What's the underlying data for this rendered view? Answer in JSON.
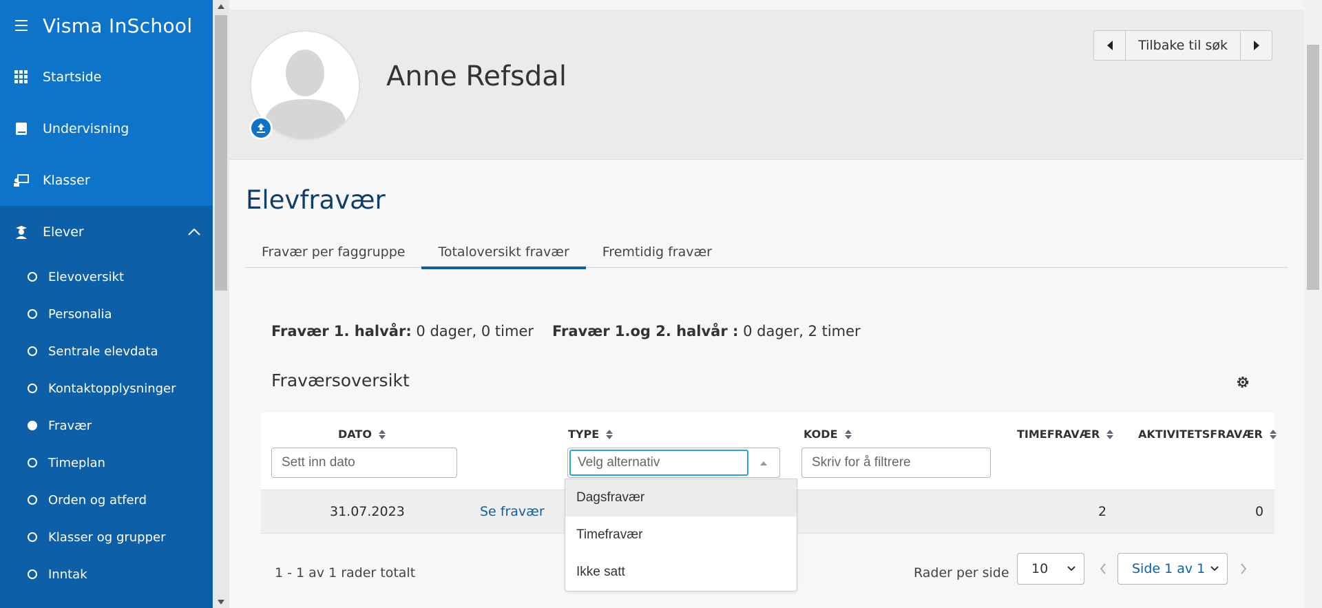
{
  "app": {
    "title": "Visma InSchool"
  },
  "sidebar": {
    "items": [
      {
        "label": "Startside"
      },
      {
        "label": "Undervisning"
      },
      {
        "label": "Klasser"
      },
      {
        "label": "Elever"
      }
    ],
    "subitems": [
      {
        "label": "Elevoversikt"
      },
      {
        "label": "Personalia"
      },
      {
        "label": "Sentrale elevdata"
      },
      {
        "label": "Kontaktopplysninger"
      },
      {
        "label": "Fravær",
        "selected": true
      },
      {
        "label": "Timeplan"
      },
      {
        "label": "Orden og atferd"
      },
      {
        "label": "Klasser og grupper"
      },
      {
        "label": "Inntak"
      }
    ]
  },
  "header": {
    "person_name": "Anne Refsdal",
    "back_label": "Tilbake til søk"
  },
  "page": {
    "title": "Elevfravær",
    "tabs": [
      {
        "label": "Fravær per faggruppe"
      },
      {
        "label": "Totaloversikt fravær",
        "active": true
      },
      {
        "label": "Fremtidig fravær"
      }
    ]
  },
  "summary": {
    "first_label": "Fravær 1. halvår:",
    "first_value": "0 dager, 0 timer",
    "both_label": "Fravær 1.og 2. halvår :",
    "both_value": "0 dager, 2 timer"
  },
  "overview": {
    "title": "Fraværsoversikt",
    "columns": [
      "DATO",
      "TYPE",
      "KODE",
      "TIMEFRAVÆR",
      "AKTIVITETSFRAVÆR"
    ],
    "filters": {
      "date_placeholder": "Sett inn dato",
      "type_placeholder": "Velg alternativ",
      "code_placeholder": "Skriv for å filtrere"
    },
    "rows": [
      {
        "date": "31.07.2023",
        "link": "Se fravær",
        "hours": "2",
        "activity": "0"
      }
    ],
    "type_options": [
      "Dagsfravær",
      "Timefravær",
      "Ikke satt"
    ],
    "total_text": "1 - 1 av 1 rader totalt",
    "rows_per_page_label": "Rader per side",
    "rows_per_page_value": "10",
    "page_value": "Side 1 av 1"
  },
  "colors": {
    "sidebar_top": "#0e74c9",
    "sidebar_bottom": "#0d5fa8",
    "accent": "#0d5fa8",
    "focus": "#2aa3dc"
  }
}
